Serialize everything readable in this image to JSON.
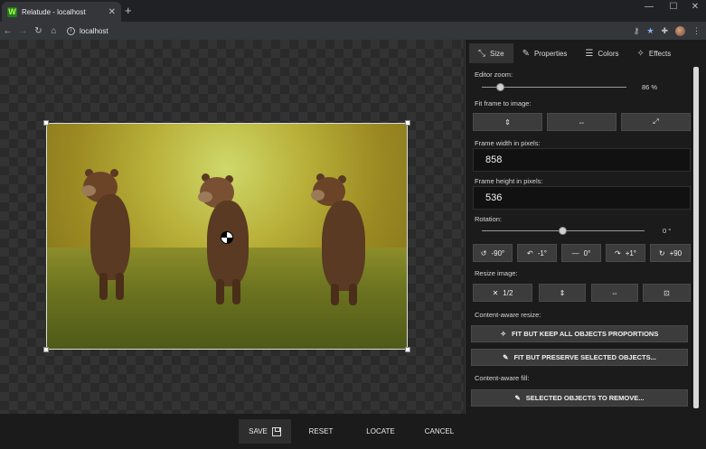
{
  "browser": {
    "tab_title": "Relatude - localhost",
    "tab_favicon": "W",
    "new_tab": "+",
    "address": "localhost",
    "window_controls": {
      "minimize": "—",
      "maximize": "☐",
      "close": "✕"
    },
    "nav": {
      "back": "←",
      "forward": "→",
      "reload": "↻",
      "home": "⌂"
    },
    "toolbar_icons": {
      "key": "⚷",
      "star": "★",
      "extensions": "✚",
      "menu": "⋮"
    }
  },
  "panel": {
    "tabs": [
      {
        "label": "Size",
        "icon": "⤡",
        "active": true
      },
      {
        "label": "Properties",
        "icon": "✎"
      },
      {
        "label": "Colors",
        "icon": "☰"
      },
      {
        "label": "Effects",
        "icon": "✧"
      }
    ],
    "editor_zoom": {
      "label": "Editor zoom:",
      "value": "86 %",
      "level_percent": 13
    },
    "fit_frame": {
      "label": "Fit frame to image:",
      "buttons": [
        "⇕",
        "⇔",
        "⤢"
      ]
    },
    "frame_width": {
      "label": "Frame width in pixels:",
      "value": "858"
    },
    "frame_height": {
      "label": "Frame height in pixels:",
      "value": "536"
    },
    "rotation": {
      "label": "Rotation:",
      "value": "0 °",
      "level_percent": 50
    },
    "rotation_buttons": [
      {
        "icon": "↺",
        "label": "-90°"
      },
      {
        "icon": "↶",
        "label": "-1°"
      },
      {
        "icon": "—",
        "label": "0°"
      },
      {
        "icon": "↷",
        "label": "+1°"
      },
      {
        "icon": "↻",
        "label": "+90"
      }
    ],
    "resize_image": {
      "label": "Resize image:",
      "buttons": [
        {
          "icon": "✕",
          "label": "1/2"
        },
        {
          "icon": "⇕",
          "label": ""
        },
        {
          "icon": "⇔",
          "label": ""
        },
        {
          "icon": "⊡",
          "label": ""
        }
      ]
    },
    "content_aware_resize": {
      "label": "Content-aware resize:",
      "fit_keep": "FIT BUT KEEP ALL OBJECTS PROPORTIONS",
      "fit_preserve": "FIT BUT PRESERVE SELECTED OBJECTS..."
    },
    "content_aware_fill": {
      "label": "Content-aware fill:",
      "remove": "SELECTED OBJECTS TO REMOVE..."
    }
  },
  "bottom": {
    "save": "SAVE",
    "reset": "RESET",
    "locate": "LOCATE",
    "cancel": "CANCEL"
  }
}
